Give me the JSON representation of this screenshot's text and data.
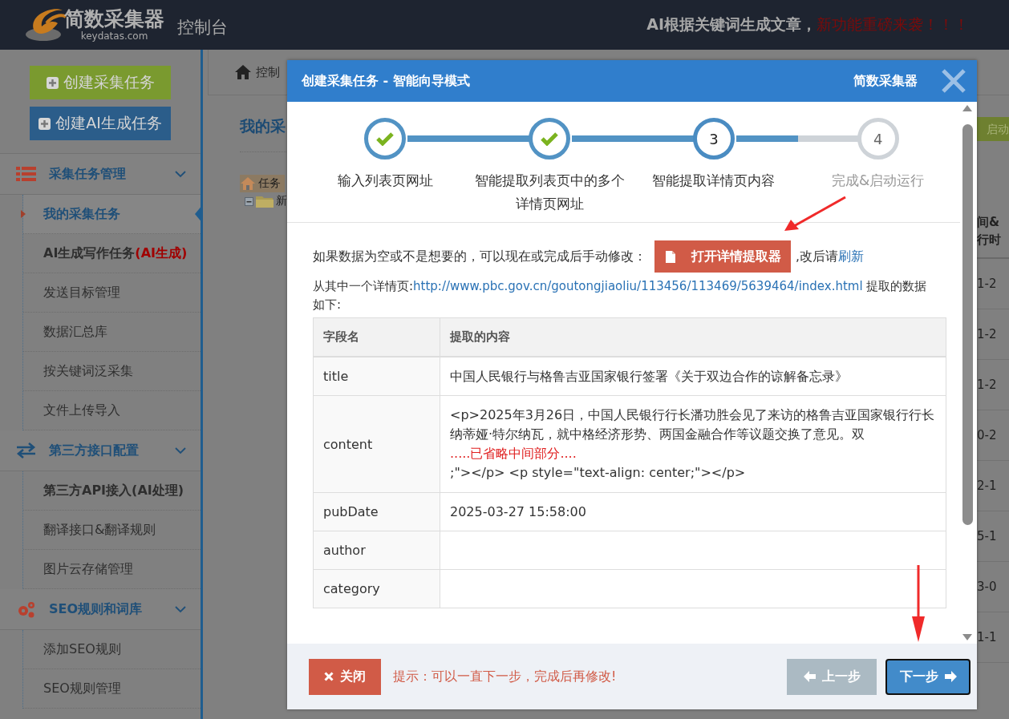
{
  "header": {
    "brand": "简数采集器",
    "domain": "keydatas.com",
    "console": "控制台",
    "notice": "AI根据关键词生成文章，",
    "notice_highlight": "新功能重磅来袭！！！"
  },
  "sidebar": {
    "buttons": [
      {
        "label": "创建采集任务",
        "kind": "collect"
      },
      {
        "label": "创建AI生成任务",
        "kind": "ai"
      }
    ],
    "sections": [
      {
        "title": "采集任务管理",
        "expanded": true,
        "items": [
          {
            "label": "我的采集任务",
            "selected": true,
            "emphasis": true
          },
          {
            "label": "AI生成写作任务",
            "tag": "(AI生成)",
            "selected": false,
            "emphasis": true
          },
          {
            "label": "发送目标管理",
            "selected": false,
            "emphasis": false
          },
          {
            "label": "数据汇总库",
            "selected": false,
            "emphasis": false
          },
          {
            "label": "按关键词泛采集",
            "selected": false,
            "emphasis": false
          },
          {
            "label": "文件上传导入",
            "selected": false,
            "emphasis": false
          }
        ]
      },
      {
        "title": "第三方接口配置",
        "expanded": true,
        "items": [
          {
            "label": "第三方API接入(AI处理)",
            "selected": false,
            "emphasis": true
          },
          {
            "label": "翻译接口&翻译规则",
            "selected": false,
            "emphasis": false
          },
          {
            "label": "图片云存储管理",
            "selected": false,
            "emphasis": false
          }
        ]
      },
      {
        "title": "SEO规则和词库",
        "expanded": true,
        "items": [
          {
            "label": "添加SEO规则",
            "selected": false,
            "emphasis": false
          },
          {
            "label": "SEO规则管理",
            "selected": false,
            "emphasis": false
          }
        ]
      }
    ]
  },
  "main": {
    "breadcrumb": "控制",
    "heading": "我的采",
    "tree": [
      {
        "label": "任务",
        "kind": "root"
      },
      {
        "label": "新",
        "kind": "folder"
      }
    ],
    "right_column": {
      "button": "启动",
      "header": [
        "间&",
        "行时"
      ],
      "cells": [
        "1-2",
        "1-2",
        "1-2",
        "0-2",
        "2-1",
        "5-1",
        "3-0",
        "1-1"
      ]
    }
  },
  "dialog": {
    "title": "创建采集任务 - 智能向导模式",
    "brand": "简数采集器",
    "steps": [
      {
        "label": "输入列表页网址",
        "completed": true,
        "active": false,
        "connector": {
          "level": 1
        }
      },
      {
        "label": "智能提取列表页中的多个详情页网址",
        "completed": true,
        "active": false,
        "connector": {
          "level": 1
        }
      },
      {
        "number": "3",
        "label": "智能提取详情页内容",
        "completed": false,
        "active": true,
        "connector": {
          "level": 0.5
        }
      },
      {
        "number": "4",
        "label": "完成&启动运行",
        "completed": false,
        "active": false
      }
    ],
    "hint_before": "如果数据为空或不是想要的，可以现在或完成后手动修改：",
    "extractor_button": "打开详情提取器",
    "hint_after": ",改后请",
    "refresh_link": "刷新",
    "source_prefix": "从其中一个详情页:",
    "source_url": "http://www.pbc.gov.cn/goutongjiaoliu/113456/113469/5639464/index.html",
    "source_suffix": " 提取的数据如下:",
    "table": {
      "columns": [
        "字段名",
        "提取的内容"
      ],
      "rows": [
        {
          "field": "title",
          "value": [
            {
              "text": "中国人民银行与格鲁吉亚国家银行签署《关于双边合作的谅解备忘录》",
              "kind": "normal"
            }
          ]
        },
        {
          "field": "content",
          "value": [
            {
              "text": "<p>2025年3月26日，中国人民银行行长潘功胜会见了来访的格鲁吉亚国家银行行长纳蒂娅·特尔纳瓦，就中格经济形势、两国金融合作等议题交换了意见。双",
              "kind": "normal"
            },
            {
              "text": ".....已省略中间部分....",
              "kind": "omitted"
            },
            {
              "text": ";\"></p> <p style=\"text-align: center;\"></p>",
              "kind": "normal"
            }
          ]
        },
        {
          "field": "pubDate",
          "value": [
            {
              "text": "2025-03-27 15:58:00",
              "kind": "normal"
            }
          ]
        },
        {
          "field": "author",
          "value": []
        },
        {
          "field": "category",
          "value": []
        }
      ]
    },
    "close_button": "关闭",
    "footer_hint": "提示：可以一直下一步，完成后再修改!",
    "prev_button": {
      "label": "上一步",
      "disabled": true
    },
    "next_button": {
      "label": "下一步",
      "disabled": false
    }
  }
}
